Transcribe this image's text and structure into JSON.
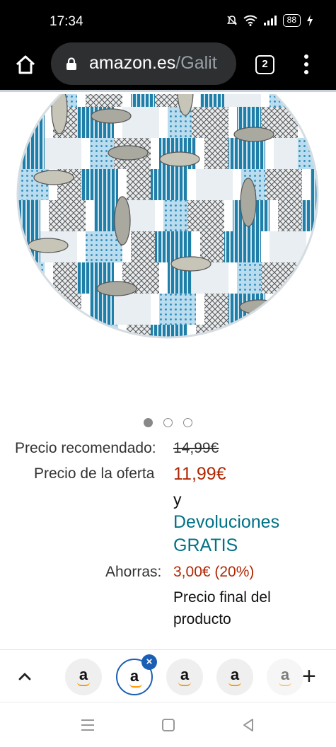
{
  "status_bar": {
    "time": "17:34",
    "battery": "88",
    "icons": [
      "mute-icon",
      "wifi-icon",
      "signal-icon",
      "battery-icon",
      "charging-icon"
    ]
  },
  "browser": {
    "url_domain": "amazon.es",
    "url_path": "/Galit",
    "tab_count": "2"
  },
  "product": {
    "image_alt_icon": "round-tablecloth-fish-pattern",
    "carousel": {
      "total": 3,
      "active": 0
    }
  },
  "price": {
    "recommended_label": "Precio recomendado:",
    "recommended_value": "14,99€",
    "offer_label": "Precio de la oferta",
    "offer_value": "11,99€",
    "and_text": "y",
    "returns_line1": "Devoluciones",
    "returns_line2": "GRATIS",
    "savings_label": "Ahorras:",
    "savings_value": "3,00€ (20%)",
    "final_line1": "Precio final del",
    "final_line2": "producto"
  },
  "tab_strip": {
    "tabs": [
      {
        "letter": "a",
        "selected": false
      },
      {
        "letter": "a",
        "selected": true
      },
      {
        "letter": "a",
        "selected": false
      },
      {
        "letter": "a",
        "selected": false
      },
      {
        "letter": "a",
        "selected": false
      }
    ],
    "close_symbol": "×",
    "new_tab_symbol": "+"
  },
  "colors": {
    "deal_red": "#b12704",
    "link_teal": "#007185",
    "selected_tab_blue": "#1a5fb4",
    "pattern_blue": "#1f7fa8"
  }
}
